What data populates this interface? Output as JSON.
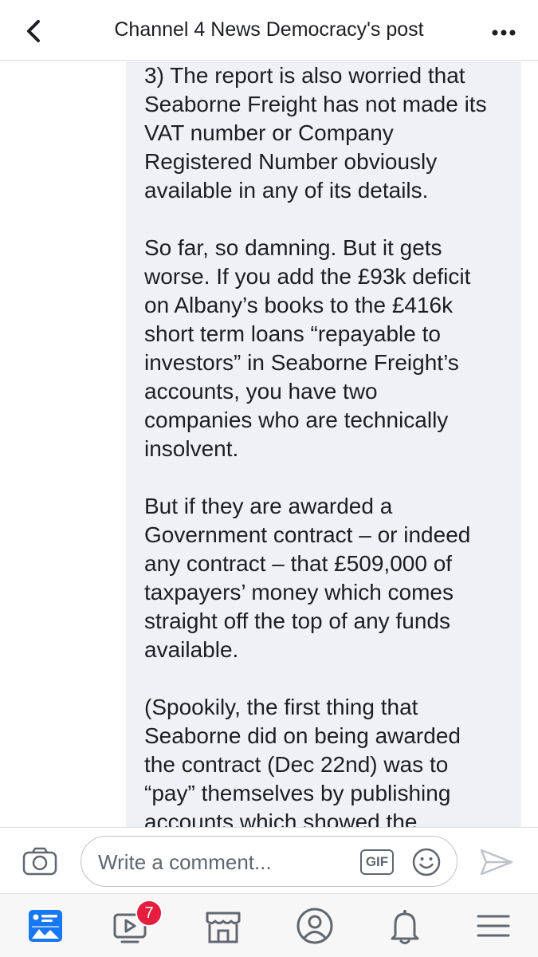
{
  "header": {
    "title": "Channel 4 News Democracy's post",
    "back_icon": "chevron-left-icon",
    "more_icon": "more-dots-icon"
  },
  "post": {
    "paragraphs": [
      "3) The report is also worried that\nSeaborne Freight has not made its\nVAT number or Company\nRegistered Number obviously\navailable in any of its details.",
      "So far, so damning. But it gets\nworse.  If you add the £93k deficit\non Albany’s books to the £416k\nshort term loans “repayable to\ninvestors” in Seaborne Freight’s\naccounts, you have two\ncompanies who are technically\ninsolvent.",
      "But if they are awarded a\nGovernment contract – or indeed\nany contract – that £509,000 of\ntaxpayers’ money which comes\nstraight off the top of any funds\navailable.",
      "(Spookily, the first thing that\nSeaborne did on being awarded\nthe contract (Dec 22nd) was to\n“pay” themselves by publishing\naccounts which showed the"
    ]
  },
  "comment_bar": {
    "placeholder": "Write a comment...",
    "gif_label": "GIF",
    "camera_icon": "camera-icon",
    "emoji_icon": "smiley-icon",
    "send_icon": "send-icon"
  },
  "tabbar": {
    "tabs": [
      {
        "name": "news-feed",
        "icon": "news-feed-icon"
      },
      {
        "name": "watch",
        "icon": "video-play-icon",
        "badge": "7"
      },
      {
        "name": "marketplace",
        "icon": "marketplace-icon"
      },
      {
        "name": "profile",
        "icon": "profile-icon"
      },
      {
        "name": "notifications",
        "icon": "bell-icon"
      },
      {
        "name": "menu",
        "icon": "hamburger-menu-icon"
      }
    ]
  },
  "colors": {
    "accent": "#1877f2",
    "badge": "#e41e3f",
    "bubble": "#f0f1f4",
    "icon_gray": "#606770"
  }
}
